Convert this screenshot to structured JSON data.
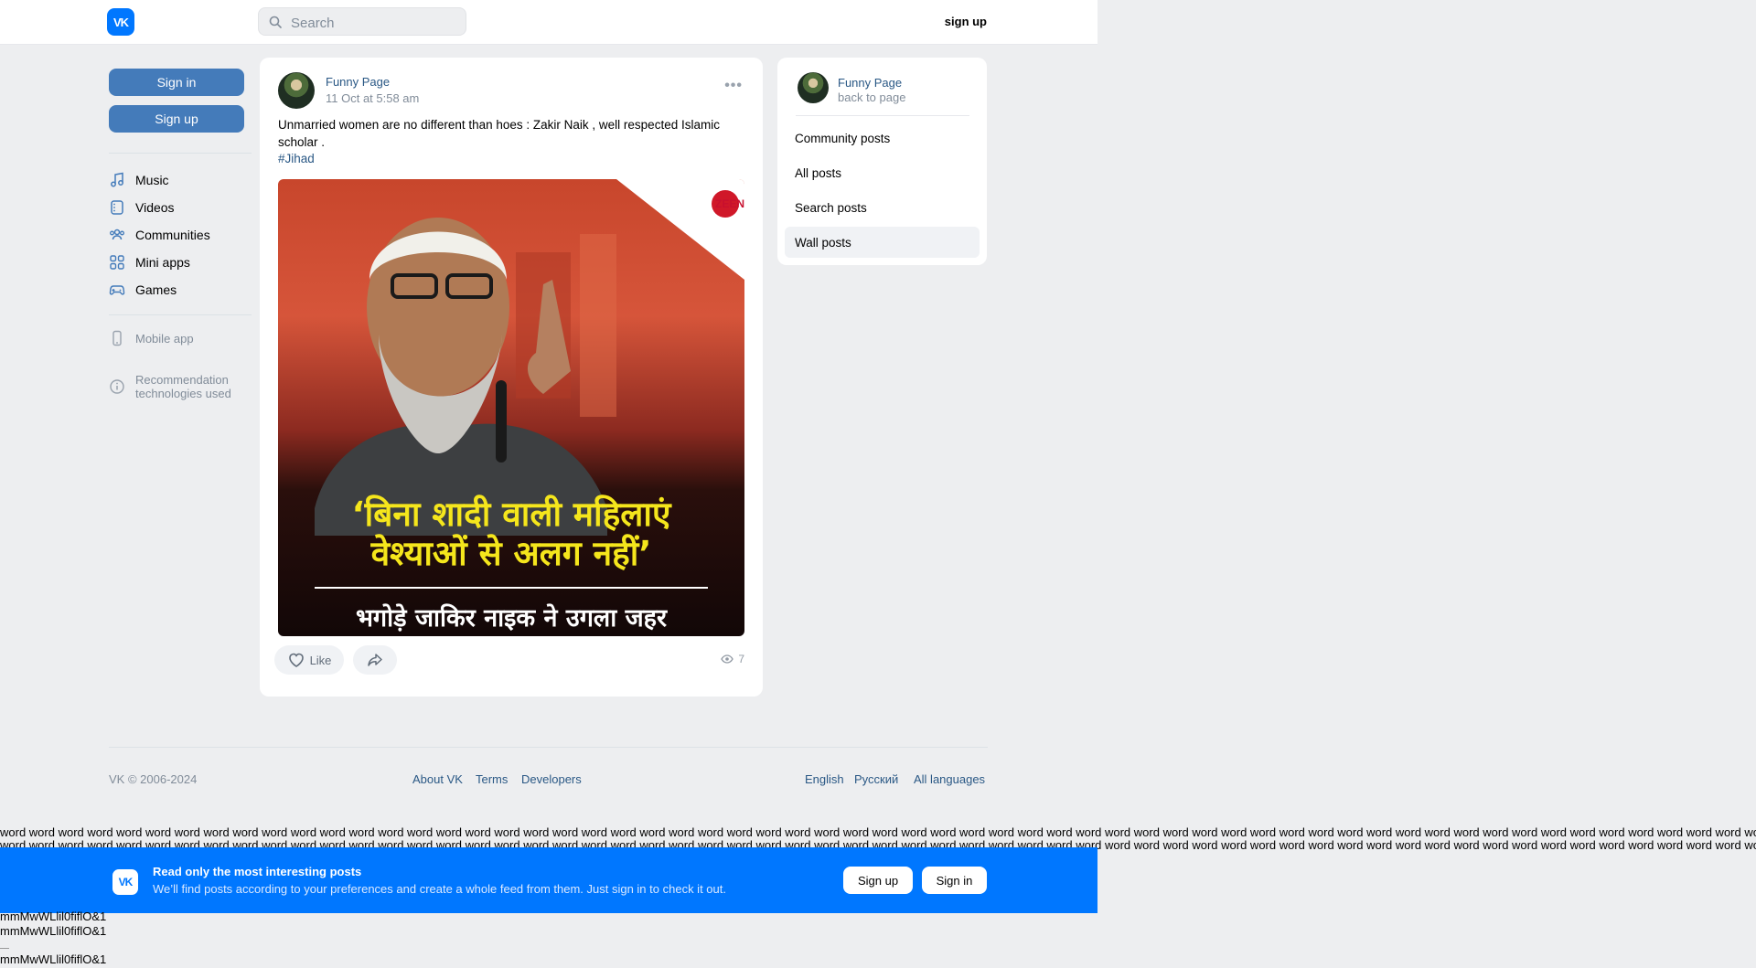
{
  "header": {
    "logo_text": "VK",
    "search_placeholder": "Search",
    "signup_label": "sign up"
  },
  "left_nav": {
    "sign_in": "Sign in",
    "sign_up": "Sign up",
    "items": [
      {
        "label": "Music",
        "icon": "music-icon"
      },
      {
        "label": "Videos",
        "icon": "video-icon"
      },
      {
        "label": "Communities",
        "icon": "communities-icon"
      },
      {
        "label": "Mini apps",
        "icon": "apps-icon"
      },
      {
        "label": "Games",
        "icon": "gamepad-icon"
      }
    ],
    "mobile_app": "Mobile app",
    "recommendation_line1": "Recommendation",
    "recommendation_line2": "technologies used"
  },
  "post": {
    "author": "Funny Page",
    "date": "11 Oct at 5:58 am",
    "text": "Unmarried women are no different than hoes : Zakir Naik , well respected Islamic scholar .",
    "hashtag": "#Jihad",
    "image": {
      "badge": "ZEENEWS",
      "headline_line1": "‘बिना शादी वाली महिलाएं",
      "headline_line2": "वेश्याओं से अलग नहीं’",
      "footer_line": "भगोड़े जाकिर नाइक ने उगला जहर"
    },
    "like_label": "Like",
    "views": "7"
  },
  "side_menu": {
    "page_name": "Funny Page",
    "back_label": "back to page",
    "items": [
      {
        "label": "Community posts",
        "active": false
      },
      {
        "label": "All posts",
        "active": false
      },
      {
        "label": "Search posts",
        "active": false
      },
      {
        "label": "Wall posts",
        "active": true
      }
    ]
  },
  "footer": {
    "copyright": "VK © 2006-2024",
    "links": [
      "About VK",
      "Terms",
      "Developers"
    ],
    "languages": [
      "English",
      "Русский",
      "All languages"
    ]
  },
  "filler": {
    "words_line": "word word word word word word word word word word word word word word word word word word word word word word word word word word word word word word word word word word word word word word word word word word word word word word word word word word word word word word word word word word word word word word word word word word word word word",
    "mono_line": "mmMwWLlil0fiflO&1"
  },
  "banner": {
    "title": "Read only the most interesting posts",
    "subtitle": "We’ll find posts according to your preferences and create a whole feed from them. Just sign in to check it out.",
    "sign_up": "Sign up",
    "sign_in": "Sign in",
    "color": "#0077ff"
  }
}
